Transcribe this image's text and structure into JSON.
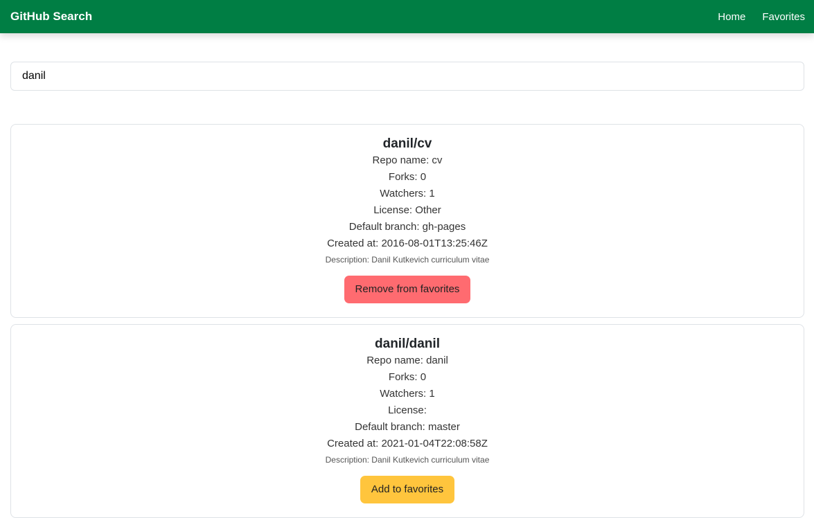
{
  "nav": {
    "brand": "GitHub Search",
    "home": "Home",
    "favorites": "Favorites"
  },
  "search": {
    "value": "danil"
  },
  "repos": [
    {
      "full_name": "danil/cv",
      "repo_name": "Repo name: cv",
      "forks": "Forks: 0",
      "watchers": "Watchers: 1",
      "license": "License: Other",
      "branch": "Default branch: gh-pages",
      "created": "Created at: 2016-08-01T13:25:46Z",
      "description": "Description: Danil Kutkevich curriculum vitae",
      "button": "Remove from favorites",
      "button_color": "#ff6b70"
    },
    {
      "full_name": "danil/danil",
      "repo_name": "Repo name: danil",
      "forks": "Forks: 0",
      "watchers": "Watchers: 1",
      "license": "License:",
      "branch": "Default branch: master",
      "created": "Created at: 2021-01-04T22:08:58Z",
      "description": "Description: Danil Kutkevich curriculum vitae",
      "button": "Add to favorites",
      "button_color": "#ffc53d"
    }
  ]
}
